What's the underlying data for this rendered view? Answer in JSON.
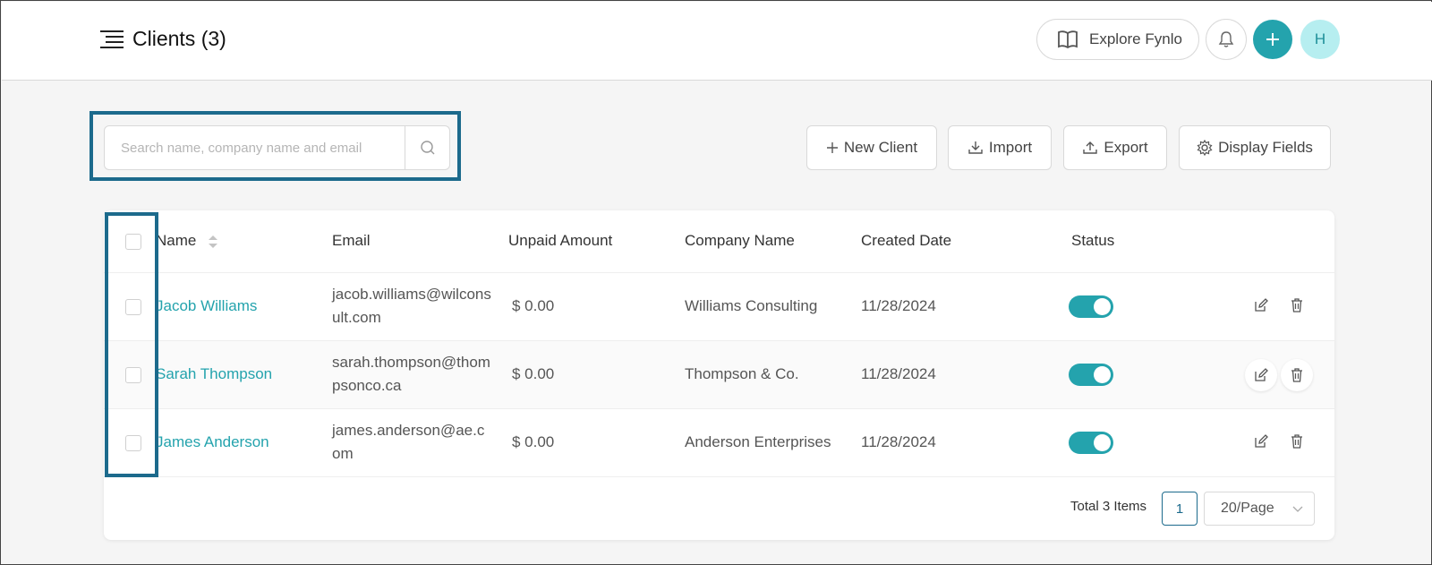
{
  "header": {
    "title": "Clients (3)",
    "explore_label": "Explore Fynlo",
    "avatar_initial": "H"
  },
  "search": {
    "placeholder": "Search name, company name and email",
    "value": ""
  },
  "toolbar": {
    "new_client_label": "New Client",
    "import_label": "Import",
    "export_label": "Export",
    "display_fields_label": "Display Fields"
  },
  "table": {
    "columns": {
      "name": "Name",
      "email": "Email",
      "unpaid": "Unpaid Amount",
      "company": "Company Name",
      "created": "Created Date",
      "status": "Status"
    },
    "rows": [
      {
        "name": "Jacob Williams",
        "email": "jacob.williams@wilconsult.com",
        "unpaid": "$ 0.00",
        "company": "Williams Consulting",
        "created": "11/28/2024",
        "active": true
      },
      {
        "name": "Sarah Thompson",
        "email": "sarah.thompson@thompsonco.ca",
        "unpaid": "$ 0.00",
        "company": "Thompson & Co.",
        "created": "11/28/2024",
        "active": true
      },
      {
        "name": "James Anderson",
        "email": "james.anderson@ae.com",
        "unpaid": "$ 0.00",
        "company": "Anderson Enterprises",
        "created": "11/28/2024",
        "active": true
      }
    ]
  },
  "pagination": {
    "total_label": "Total 3 Items",
    "current_page": "1",
    "page_size_label": "20/Page"
  },
  "colors": {
    "accent": "#24a3ad",
    "highlight": "#1c6a8c"
  }
}
